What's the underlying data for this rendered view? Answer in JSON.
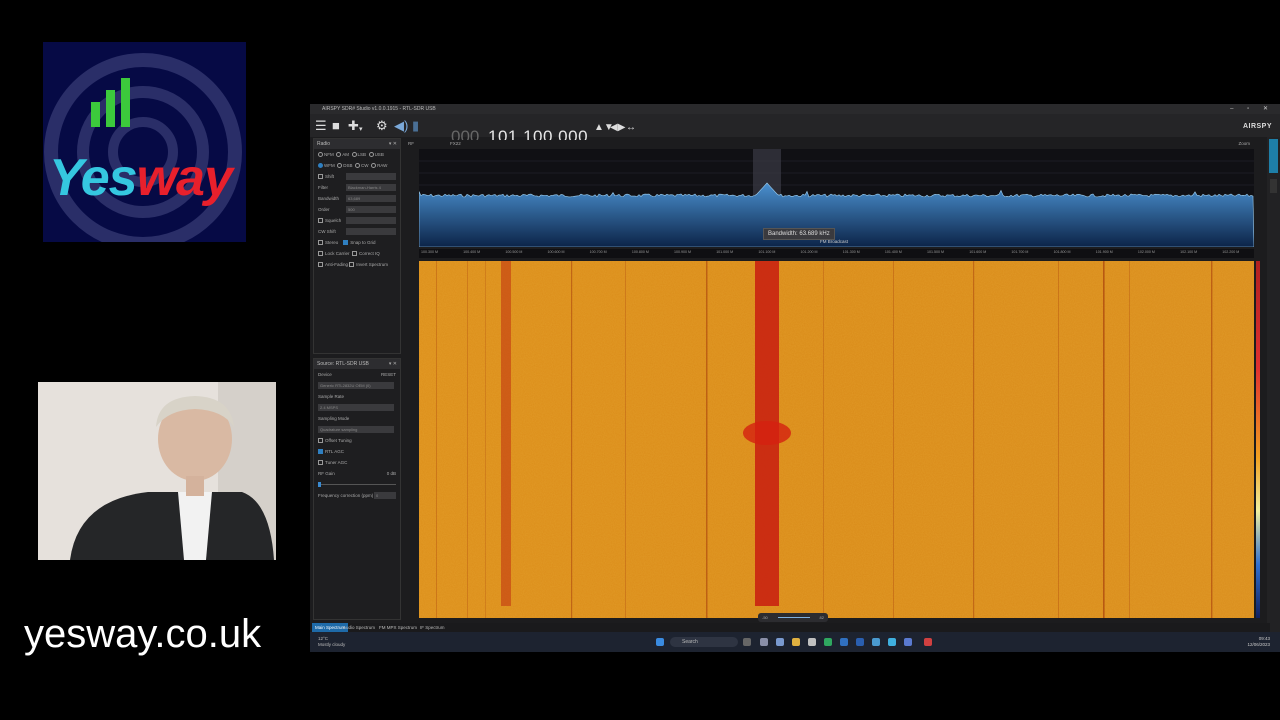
{
  "logo": {
    "text_yes": "Yes",
    "text_way": "way",
    "colors": {
      "bg": "#060a45",
      "yes": "#35c7e0",
      "way": "#e8202c",
      "bars": "#3cc93c"
    }
  },
  "site_url": "yesway.co.uk",
  "sdr": {
    "title": "AIRSPY SDR# Studio v1.0.0.1915 - RTL-SDR USB",
    "brand": "AIRSPY",
    "frequency_dim": "000",
    "frequency": "101.100.000",
    "spectrum_header": {
      "left": "RF",
      "mid": "FX22",
      "right": "Zoom"
    },
    "tooltip": "Bandwidth: 63.689 kHz",
    "fm_label": "FM Broadcast",
    "zoom_label": "-50",
    "zoom_value": "82",
    "radio_panel": {
      "title": "Radio",
      "modes_row1": [
        "NFM",
        "AM",
        "LSB",
        "USB"
      ],
      "modes_row2": [
        "WFM",
        "DSB",
        "CW",
        "RAW"
      ],
      "shift_label": "Shift",
      "filter_label": "Filter",
      "filter_value": "Blackman-Harris 4",
      "bandwidth_label": "Bandwidth",
      "bandwidth_value": "63,689",
      "order_label": "Order",
      "order_value": "500",
      "squelch_label": "Squelch",
      "cw_shift_label": "CW Shift",
      "opts": [
        "Stereo",
        "Snap to Grid",
        "Lock Carrier",
        "Correct IQ",
        "Anti-Fading",
        "Invert Spectrum"
      ]
    },
    "source_panel": {
      "title": "Source: RTL-SDR USB",
      "device_label": "Device",
      "device_value": "Generic RTL2832U OEM (0)",
      "refresh": "RESET",
      "sample_rate_label": "Sample Rate",
      "sample_rate_value": "2.4 MSPS",
      "sampling_mode_label": "Sampling Mode",
      "sampling_mode_value": "Quadrature sampling",
      "offset_tuning": "Offset Tuning",
      "rtl_agc": "RTL AGC",
      "tuner_agc": "Tuner AGC",
      "rf_gain_label": "RF Gain",
      "rf_gain_value": "0 dB",
      "ppm_label": "Frequency correction (ppm)",
      "ppm_value": "0"
    },
    "axis_ticks": [
      "100.300 M",
      "100.400 M",
      "100.500 M",
      "100.600 M",
      "100.700 M",
      "100.800 M",
      "100.900 M",
      "101.000 M",
      "101.100 M",
      "101.200 M",
      "101.300 M",
      "101.400 M",
      "101.500 M",
      "101.600 M",
      "101.700 M",
      "101.800 M",
      "101.900 M",
      "102.000 M",
      "102.100 M",
      "102.200 M"
    ],
    "bottom_tabs": [
      "Main Spectrum",
      "Audio Spectrum",
      "FM MPX Spectrum",
      "IF Spectrum"
    ],
    "right_tabs": [
      "Frequency Manager",
      "Display"
    ]
  },
  "taskbar": {
    "weather_temp": "12°C",
    "weather_desc": "Mostly cloudy",
    "search": "Search",
    "time": "09:43",
    "date": "12/06/2023"
  }
}
